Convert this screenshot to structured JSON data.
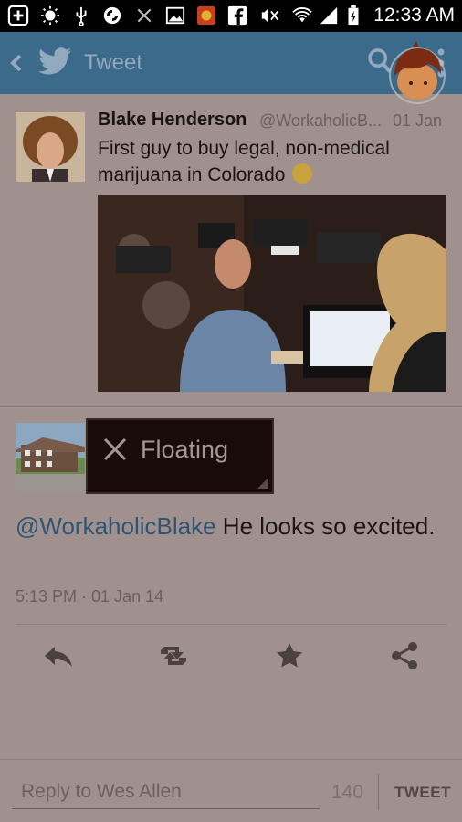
{
  "status_bar": {
    "time": "12:33 AM",
    "icons": [
      "add-icon",
      "brightness-icon",
      "usb-icon",
      "sync-icon",
      "close-icon",
      "image-icon",
      "app-icon",
      "facebook-icon",
      "signal-mute-icon",
      "wifi-icon",
      "cell-signal-icon",
      "battery-icon"
    ]
  },
  "action_bar": {
    "title": "Tweet",
    "back_icon": "chevron-left-icon",
    "logo_icon": "twitter-bird-icon",
    "search_icon": "search-icon",
    "overflow_icon": "overflow-menu-icon"
  },
  "main_tweet": {
    "name": "Blake Henderson",
    "handle": "@WorkaholicB...",
    "date": "01 Jan",
    "text": "First guy to buy legal, non-medical marijuana in Colorado",
    "emoji": "laughing-emoji"
  },
  "floating_window": {
    "label": "Floating",
    "close_icon": "close-icon"
  },
  "reply_tweet": {
    "mention": "@WorkaholicBlake",
    "text": " He looks so excited.",
    "meta": "5:13 PM · 01 Jan 14"
  },
  "actions": [
    {
      "name": "reply-icon"
    },
    {
      "name": "retweet-icon"
    },
    {
      "name": "favorite-icon"
    },
    {
      "name": "share-icon"
    }
  ],
  "reply_bar": {
    "placeholder": "Reply to Wes Allen",
    "char_count": "140",
    "tweet_button": "TWEET"
  },
  "colors": {
    "action_bar": "#3b6a8b",
    "background_dimmed": "#a1918e",
    "mention_link": "#2f5573",
    "floating_bg": "#180b09"
  }
}
